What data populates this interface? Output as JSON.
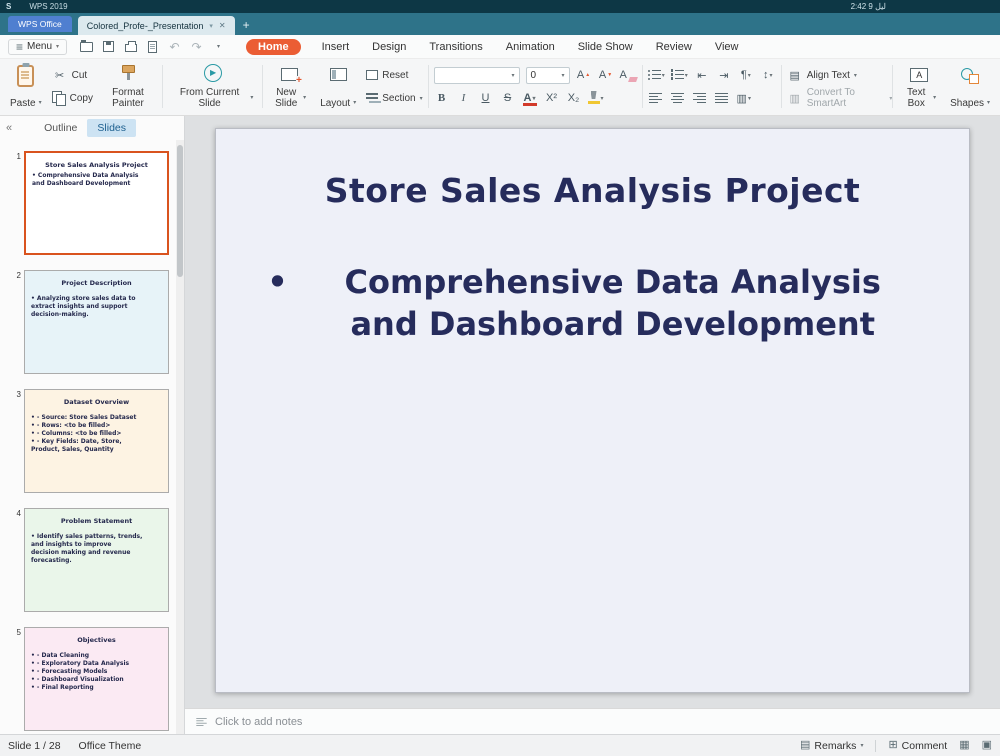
{
  "titlebar": {
    "logo": "S",
    "app_name": "WPS 2019",
    "clock": "2:42 9 ليل"
  },
  "tabbar": {
    "home_button": "WPS Office",
    "document_tab": "Colored_Profe-_Presentation",
    "new_tab": "+"
  },
  "menubar": {
    "menu_label": "Menu",
    "tabs": [
      "Home",
      "Insert",
      "Design",
      "Transitions",
      "Animation",
      "Slide Show",
      "Review",
      "View"
    ]
  },
  "ribbon": {
    "paste": "Paste",
    "cut": "Cut",
    "copy": "Copy",
    "format_painter": "Format Painter",
    "from_current_slide": "From Current Slide",
    "new_slide": "New Slide",
    "layout": "Layout",
    "reset": "Reset",
    "section": "Section",
    "font_name": "",
    "font_size": "0",
    "align_text": "Align Text",
    "convert_smartart": "Convert To SmartArt",
    "text_box": "Text Box",
    "shapes": "Shapes",
    "textbox_a": "A"
  },
  "sidebar": {
    "collapse": "«",
    "outline_tab": "Outline",
    "slides_tab": "Slides",
    "thumbnails": [
      {
        "num": "1",
        "title": "Store Sales Analysis Project",
        "body": "• Comprehensive Data Analysis\nand Dashboard Development",
        "bg": "#ffffff"
      },
      {
        "num": "2",
        "title": "Project Description",
        "body": "• Analyzing store sales data to\nextract insights and support\ndecision-making.",
        "bg": "#e7f3f8"
      },
      {
        "num": "3",
        "title": "Dataset Overview",
        "body": "• - Source: Store Sales Dataset\n• - Rows: <to be filled>\n• - Columns: <to be filled>\n• - Key Fields: Date, Store,\nProduct, Sales, Quantity",
        "bg": "#fdf3e3"
      },
      {
        "num": "4",
        "title": "Problem Statement",
        "body": "• Identify sales patterns, trends,\nand insights to improve\ndecision making and revenue\nforecasting.",
        "bg": "#eaf6ea"
      },
      {
        "num": "5",
        "title": "Objectives",
        "body": "• - Data Cleaning\n• - Exploratory Data Analysis\n• - Forecasting Models\n• - Dashboard Visualization\n• - Final Reporting",
        "bg": "#fbeaf3"
      }
    ]
  },
  "slide": {
    "title": "Store Sales Analysis Project",
    "bullet_marker": "•",
    "bullet_text": "Comprehensive Data Analysis and Dashboard Development"
  },
  "notes": {
    "placeholder": "Click to add notes"
  },
  "statusbar": {
    "slide_indicator": "Slide 1 / 28",
    "theme": "Office Theme",
    "remarks": "Remarks",
    "comment": "Comment"
  },
  "icons": {
    "caret": "▾",
    "close": "✕",
    "ghost": "▾",
    "menu": "≡",
    "undo": "↶",
    "redo": "↷",
    "scissors": "✂",
    "play": "▶",
    "letter_a": "A",
    "bold": "B",
    "italic": "I",
    "underline": "U",
    "strike": "S",
    "sup": "X²",
    "sub": "X₂",
    "tri_up": "▲",
    "tri_down": "▼",
    "indent_dec": "⇤",
    "indent_inc": "⇥",
    "line_spacing": "↕",
    "pilcrow": "¶",
    "columns": "▥",
    "align_text_icon": "▤",
    "smartart_icon": "▥",
    "remarks_icon": "▤",
    "comment_icon": "⊞",
    "view_grid": "▦",
    "view_normal": "▣"
  }
}
